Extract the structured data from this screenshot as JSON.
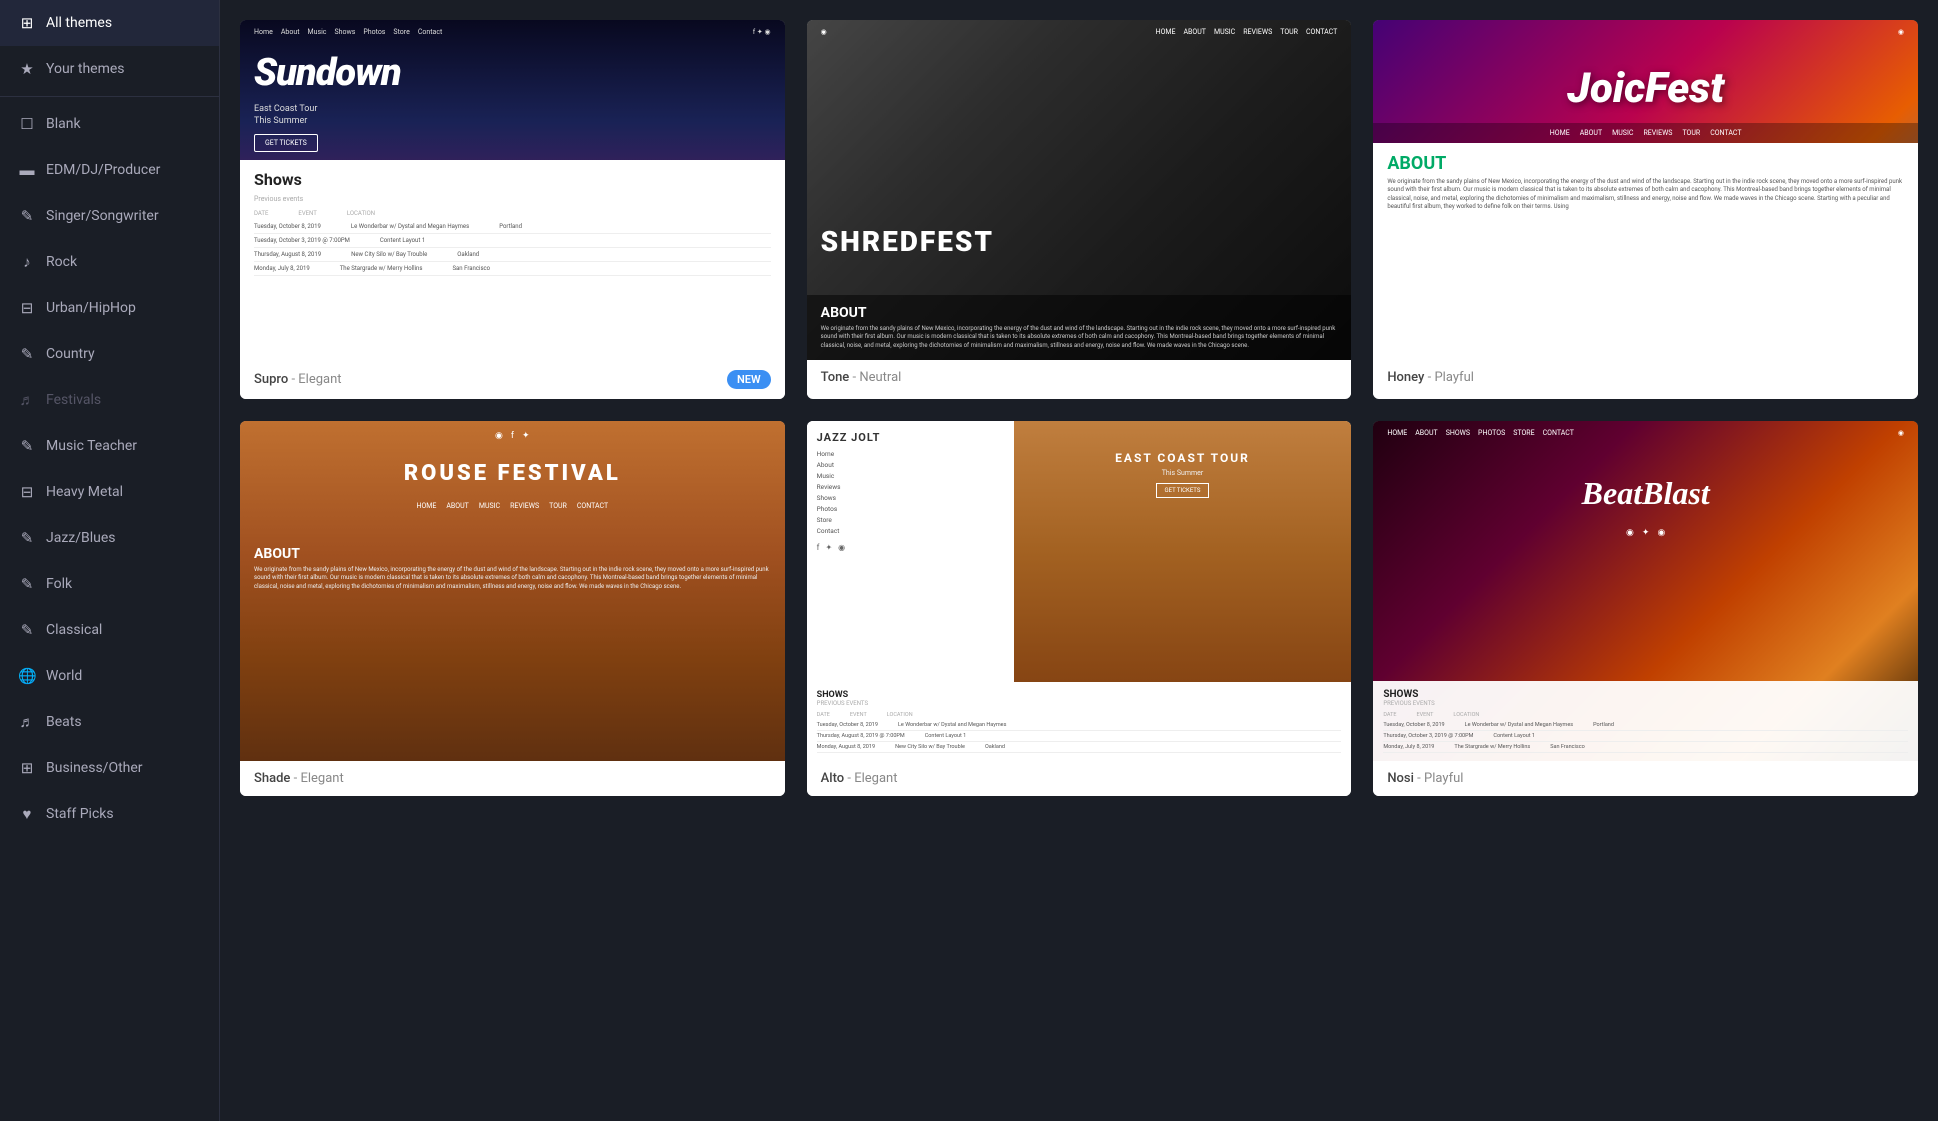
{
  "sidebar": {
    "sections": {
      "top": [
        {
          "id": "all-themes",
          "label": "All themes",
          "icon": "⊞",
          "active": true
        },
        {
          "id": "your-themes",
          "label": "Your themes",
          "icon": "★",
          "active": false
        }
      ],
      "categories": [
        {
          "id": "blank",
          "label": "Blank",
          "icon": "☐"
        },
        {
          "id": "edm-dj-producer",
          "label": "EDM/DJ/Producer",
          "icon": "▬"
        },
        {
          "id": "singer-songwriter",
          "label": "Singer/Songwriter",
          "icon": "✎"
        },
        {
          "id": "rock",
          "label": "Rock",
          "icon": "♪"
        },
        {
          "id": "urban-hiphop",
          "label": "Urban/HipHop",
          "icon": "⊟"
        },
        {
          "id": "country",
          "label": "Country",
          "icon": "✎"
        },
        {
          "id": "festivals",
          "label": "Festivals",
          "icon": "♬"
        },
        {
          "id": "music-teacher",
          "label": "Music Teacher",
          "icon": "✎"
        },
        {
          "id": "heavy-metal",
          "label": "Heavy Metal",
          "icon": "⊟"
        },
        {
          "id": "jazz-blues",
          "label": "Jazz/Blues",
          "icon": "✎"
        },
        {
          "id": "folk",
          "label": "Folk",
          "icon": "✎"
        },
        {
          "id": "classical",
          "label": "Classical",
          "icon": "✎"
        },
        {
          "id": "world",
          "label": "World",
          "icon": "🌐"
        },
        {
          "id": "beats",
          "label": "Beats",
          "icon": "♬"
        },
        {
          "id": "business-other",
          "label": "Business/Other",
          "icon": "⊞"
        },
        {
          "id": "staff-picks",
          "label": "Staff Picks",
          "icon": "♥"
        }
      ]
    }
  },
  "themes": [
    {
      "id": "supro",
      "name": "Supro",
      "style": "Elegant",
      "badge": "NEW",
      "preview_type": "sundown"
    },
    {
      "id": "tone",
      "name": "Tone",
      "style": "Neutral",
      "badge": "",
      "preview_type": "shredfest"
    },
    {
      "id": "honey",
      "name": "Honey",
      "style": "Playful",
      "badge": "",
      "preview_type": "honey"
    },
    {
      "id": "shade",
      "name": "Shade",
      "style": "Elegant",
      "badge": "",
      "preview_type": "shade"
    },
    {
      "id": "alto",
      "name": "Alto",
      "style": "Elegant",
      "badge": "",
      "preview_type": "alto"
    },
    {
      "id": "nosi",
      "name": "Nosi",
      "style": "Playful",
      "badge": "",
      "preview_type": "nosi"
    }
  ],
  "preview_texts": {
    "sundown": {
      "nav": [
        "Home",
        "About",
        "Music",
        "Shows",
        "Photos",
        "Store",
        "Contact"
      ],
      "hero": "Sundown",
      "subtitle": "East Coast Tour",
      "subtitle2": "This Summer",
      "cta": "GET TICKETS",
      "shows_title": "Shows",
      "shows_subtitle": "Previous events",
      "table_headers": [
        "DATE",
        "EVENT",
        "LOCATION"
      ],
      "rows": [
        [
          "Tuesday, October 8, 2019",
          "Le Wonderbar w/ Dystal and Megan Haymes",
          "Portland"
        ],
        [
          "Tuesday, October 3, 2019 @ 7:00PM",
          "Content Layout 1",
          ""
        ],
        [
          "Thursday, August 8, 2019",
          "New City Silo w/ Bay Trouble",
          "Oakland"
        ],
        [
          "Monday, July 8, 2019",
          "The Stargrade w/ Merry Hollins",
          "San Francisco"
        ]
      ]
    },
    "shredfest": {
      "band_name": "SHREDFEST",
      "about_title": "ABOUT",
      "about_text": "We originate from the sandy plains of New Mexico, incorporating the energy of the dust and wind of the landscape. Starting out in the indie rock scene, they moved onto a more surf-inspired punk sound with their first album. Our music is modern classical that is taken to its absolute extremes of both calm and cacophony. This Montreal-based band brings together elements of minimal classical, noise, and metal, exploring the dichotomies of minimalism and maximalism, stillness and energy, noise and flow. We made waves in the Chicago scene."
    },
    "honey": {
      "band_name": "JoicFest",
      "nav": [
        "HOME",
        "ABOUT",
        "MUSIC",
        "REVIEWS",
        "TOUR",
        "CONTACT"
      ],
      "about_title": "ABOUT",
      "about_text": "We originate from the sandy plains of New Mexico, incorporating the energy of the dust and wind of the landscape. Starting out in the indie rock scene, they moved onto a more surf-inspired punk sound with their first album. Our music is modern classical that is taken to its absolute extremes of both calm and cacophony. This Montreal-based band brings together elements of minimal classical, noise, and metal, exploring the dichotomies of minimalism and maximalism, stillness and energy, noise and flow. We made waves in the Chicago scene. Starting with a peculiar and beautiful first album, they worked to define folk on their terms. Using"
    },
    "shade": {
      "band_name": "ROUSE FESTIVAL",
      "nav": [
        "HOME",
        "ABOUT",
        "MUSIC",
        "REVIEWS",
        "TOUR",
        "CONTACT"
      ],
      "about_title": "ABOUT",
      "about_text": "We originate from the sandy plains of New Mexico, incorporating the energy of the dust and wind of the landscape. Starting out in the indie rock scene, they moved onto a more surf-inspired punk sound with their first album. Our music is modern classical that is taken to its absolute extremes of both calm and cacophony. This Montreal-based band brings together elements of minimal classical, noise and metal, exploring the dichotomies of minimalism and maximalism, stillness and energy, noise and flow. We made waves in the Chicago scene."
    },
    "alto": {
      "logo": "JAZZ JOLT",
      "nav": [
        "Home",
        "About",
        "Music",
        "Reviews",
        "Shows",
        "Photos",
        "Store",
        "Contact"
      ],
      "tour_text": "EAST COAST TOUR",
      "tour_sub": "This Summer",
      "cta": "GET TICKETS",
      "shows_title": "SHOWS",
      "shows_sub": "PREVIOUS EVENTS",
      "rows": [
        [
          "Tuesday, October 8, 2019",
          "Le Wonderbar w/ Dystal and Megan Haymes",
          ""
        ],
        [
          "Thursday, August 8, 2019 @ 7:00PM",
          "Content Layout 1",
          ""
        ],
        [
          "Monday, August 8, 2019",
          "New City Silo w/ Bay Trouble",
          "Oakland"
        ]
      ]
    },
    "nosi": {
      "band_name": "BeatBlast",
      "nav": [
        "HOME",
        "ABOUT",
        "SHOWS",
        "PHOTOS",
        "STORE",
        "CONTACT"
      ],
      "shows_title": "SHOWS",
      "shows_sub": "PREVIOUS EVENTS",
      "rows": [
        [
          "Tuesday, October 8, 2019",
          "Le Wonderbar w/ Dystal and Megan Haymes",
          "Portland"
        ],
        [
          "Thursday, October 3, 2019 @ 7:00PM",
          "Content Layout 1",
          ""
        ],
        [
          "Monday, July 8, 2019",
          "The Stargrade w/ Merry Hollins",
          "San Francisco"
        ]
      ]
    }
  }
}
